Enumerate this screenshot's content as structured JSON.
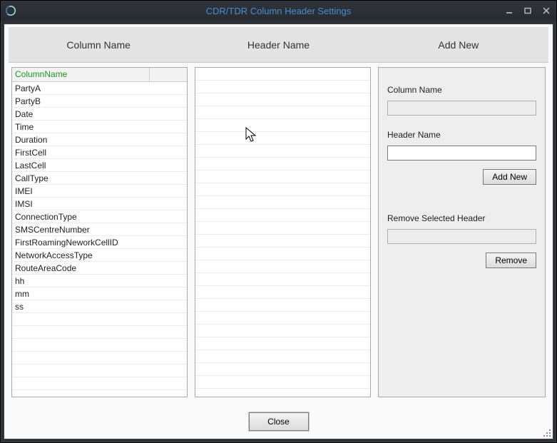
{
  "window": {
    "title": "CDR/TDR Column Header Settings"
  },
  "section_headers": {
    "col_name": "Column Name",
    "header_name": "Header Name",
    "add_new": "Add New"
  },
  "left_grid": {
    "header_label": "ColumnName",
    "rows": [
      "PartyA",
      "PartyB",
      "Date",
      "Time",
      "Duration",
      "FirstCell",
      "LastCell",
      "CallType",
      "IMEI",
      "IMSI",
      "ConnectionType",
      "SMSCentreNumber",
      "FirstRoamingNeworkCellID",
      "NetworkAccessType",
      "RouteAreaCode",
      "hh",
      "mm",
      "ss"
    ]
  },
  "middle_grid": {
    "rows": []
  },
  "form": {
    "column_name_label": "Column Name",
    "column_name_value": "",
    "header_name_label": "Header Name",
    "header_name_value": "",
    "add_new_button": "Add New",
    "remove_section_label": "Remove Selected Header",
    "remove_selected_value": "",
    "remove_button": "Remove"
  },
  "footer": {
    "close_button": "Close"
  }
}
